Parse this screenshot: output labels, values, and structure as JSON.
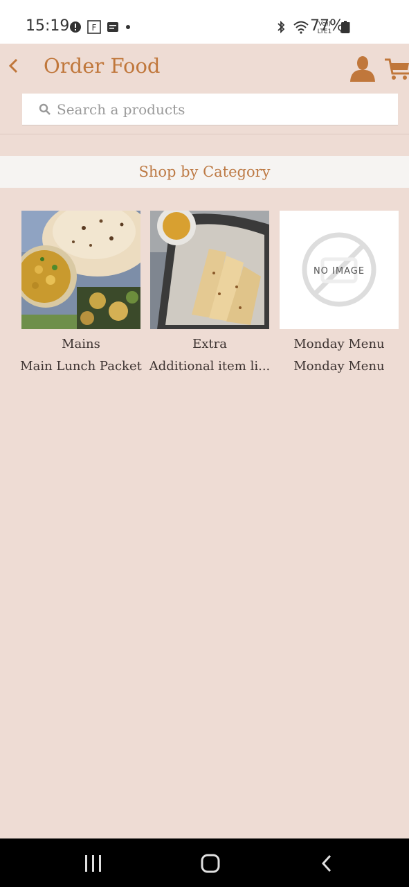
{
  "status_bar": {
    "time": "15:19",
    "battery": "77%",
    "icons_left": [
      "alert-icon",
      "flipboard-icon",
      "message-icon",
      "dot-icon"
    ],
    "icons_right": [
      "bluetooth-icon",
      "wifi-icon",
      "volte-icon",
      "signal-icon",
      "battery-icon"
    ],
    "volte_label": "Vo)) LTE1"
  },
  "header": {
    "title": "Order Food",
    "back_icon": "chevron-left-icon",
    "user_icon": "user-icon",
    "cart_icon": "cart-icon"
  },
  "search": {
    "placeholder": "Search a products",
    "icon": "search-icon"
  },
  "section": {
    "heading": "Shop by Category"
  },
  "categories": [
    {
      "title": "Mains",
      "subtitle": "Main Lunch Packet",
      "image": "mains-food-photo"
    },
    {
      "title": "Extra",
      "subtitle": "Additional item li...",
      "image": "extra-food-photo"
    },
    {
      "title": "Monday Menu",
      "subtitle": "Monday Menu",
      "image": "no-image-placeholder",
      "placeholder_text": "NO IMAGE"
    }
  ],
  "nav_bar": {
    "recent": "recent-apps-icon",
    "home": "home-icon",
    "back": "back-icon"
  },
  "colors": {
    "background": "#eedcd4",
    "accent": "#c0773b",
    "band": "#f6f4f2",
    "nav": "#000000"
  }
}
